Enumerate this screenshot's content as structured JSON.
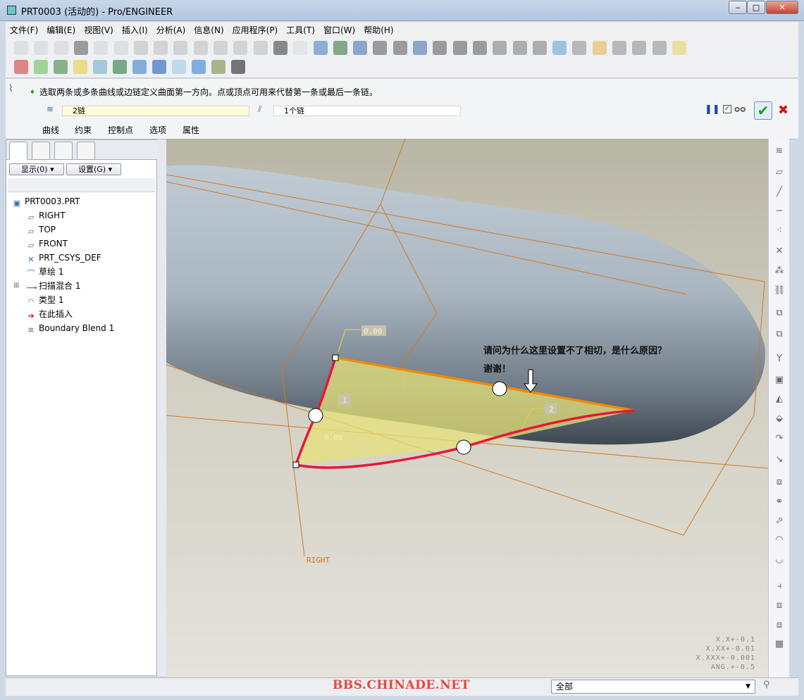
{
  "window": {
    "title": "PRT0003 (活动的) - Pro/ENGINEER",
    "minimize": "‒",
    "maximize": "□",
    "close": "✕"
  },
  "menu": [
    "文件(F)",
    "编辑(E)",
    "视图(V)",
    "插入(I)",
    "分析(A)",
    "信息(N)",
    "应用程序(P)",
    "工具(T)",
    "窗口(W)",
    "帮助(H)"
  ],
  "message": "选取两条或多条曲线或边链定义曲面第一方向。点或顶点可用来代替第一条或最后一条链。",
  "dashboard": {
    "first_direction": "2链",
    "second_direction": "1个链",
    "tabs": [
      "曲线",
      "约束",
      "控制点",
      "选项",
      "属性"
    ]
  },
  "panel": {
    "show_button": "显示(0) ▾",
    "settings_button": "设置(G) ▾",
    "tree": [
      {
        "label": "PRT0003.PRT",
        "icon": "part-icon"
      },
      {
        "label": "RIGHT",
        "icon": "datum-plane-icon"
      },
      {
        "label": "TOP",
        "icon": "datum-plane-icon"
      },
      {
        "label": "FRONT",
        "icon": "datum-plane-icon"
      },
      {
        "label": "PRT_CSYS_DEF",
        "icon": "csys-icon"
      },
      {
        "label": "草绘 1",
        "icon": "sketch-icon"
      },
      {
        "label": "扫描混合 1",
        "icon": "swept-blend-icon",
        "expandable": true
      },
      {
        "label": "类型 1",
        "icon": "surface-icon"
      },
      {
        "label": "在此插入",
        "icon": "insert-here-arrow-icon"
      },
      {
        "label": "Boundary Blend 1",
        "icon": "boundary-blend-icon"
      }
    ]
  },
  "viewport": {
    "annotation_line1": "请问为什么这里设置不了相切，是什么原因？",
    "annotation_line2": "谢谢！",
    "labels": {
      "top": "0.00",
      "left": "0.00",
      "c1": "1",
      "c2": "2",
      "plane": "RIGHT"
    },
    "tolerances": [
      "X.X+-0.1",
      "X.XX+-0.01",
      "X.XXX+-0.001",
      "ANG.+-0.5"
    ],
    "colors": {
      "model": "#a9b6c2",
      "plane": "#d07a20",
      "chain_red": "#e8163a",
      "chain_orange": "#f08a00",
      "surface": "#e6e27a",
      "background": "#e2e0d6"
    }
  },
  "status": {
    "watermark": "BBS.CHINADE.NET",
    "filter": "全部"
  }
}
